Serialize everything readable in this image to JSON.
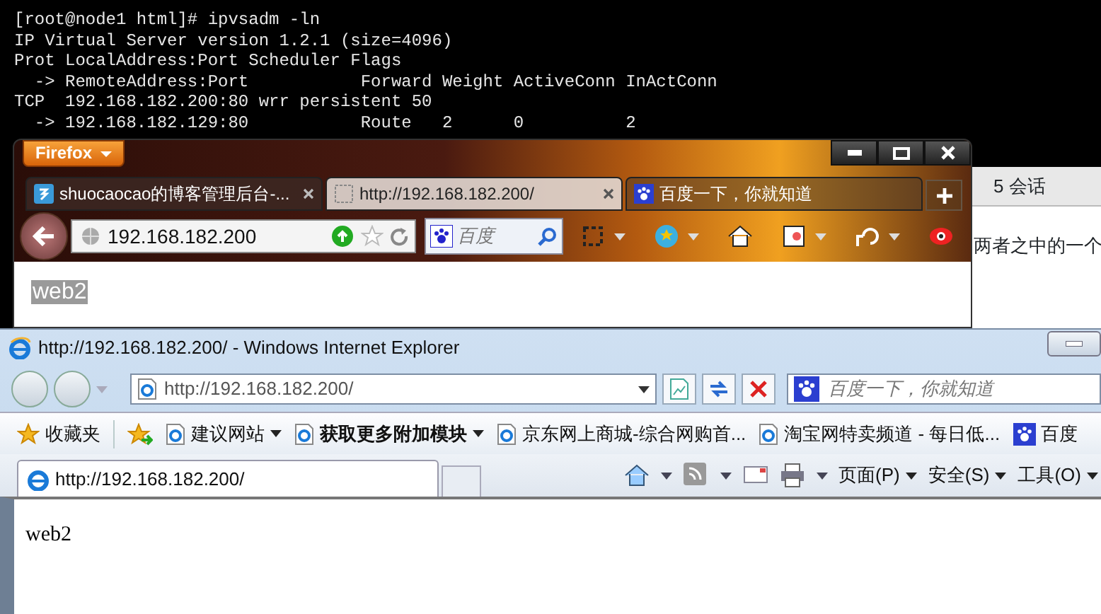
{
  "terminal": {
    "lines": [
      "[root@node1 html]# ipvsadm -ln",
      "IP Virtual Server version 1.2.1 (size=4096)",
      "Prot LocalAddress:Port Scheduler Flags",
      "  -> RemoteAddress:Port           Forward Weight ActiveConn InActConn",
      "TCP  192.168.182.200:80 wrr persistent 50",
      "  -> 192.168.182.129:80           Route   2      0          2"
    ]
  },
  "firefox_window": {
    "menu_button": "Firefox",
    "tabs": [
      {
        "label": "shuocaocao的博客管理后台-...",
        "selected": false
      },
      {
        "label": "http://192.168.182.200/",
        "selected": true
      },
      {
        "label": "百度一下，你就知道",
        "selected": false
      }
    ],
    "address": "192.168.182.200",
    "search_placeholder": "百度",
    "page_text": "web2"
  },
  "background_window": {
    "tab_label": "5 会话",
    "text": "两者之中的一个"
  },
  "ie_window": {
    "title": "http://192.168.182.200/ - Windows Internet Explorer",
    "address": "http://192.168.182.200/",
    "search_placeholder": "百度一下，你就知道",
    "favorites": [
      {
        "label": "收藏夹",
        "kind": "star",
        "has_menu": false,
        "emphasized": false
      },
      {
        "label": "建议网站",
        "kind": "page",
        "has_menu": true,
        "emphasized": false
      },
      {
        "label": "获取更多附加模块",
        "kind": "page",
        "has_menu": true,
        "emphasized": true
      },
      {
        "label": "京东网上商城-综合网购首...",
        "kind": "page",
        "has_menu": false,
        "emphasized": false
      },
      {
        "label": "淘宝网特卖频道 - 每日低...",
        "kind": "page",
        "has_menu": false,
        "emphasized": false
      },
      {
        "label": "百度",
        "kind": "paw",
        "has_menu": false,
        "emphasized": false
      }
    ],
    "tabs": [
      {
        "label": "http://192.168.182.200/",
        "selected": true
      }
    ],
    "commands": [
      "页面(P)",
      "安全(S)",
      "工具(O)"
    ],
    "page_text": "web2"
  }
}
